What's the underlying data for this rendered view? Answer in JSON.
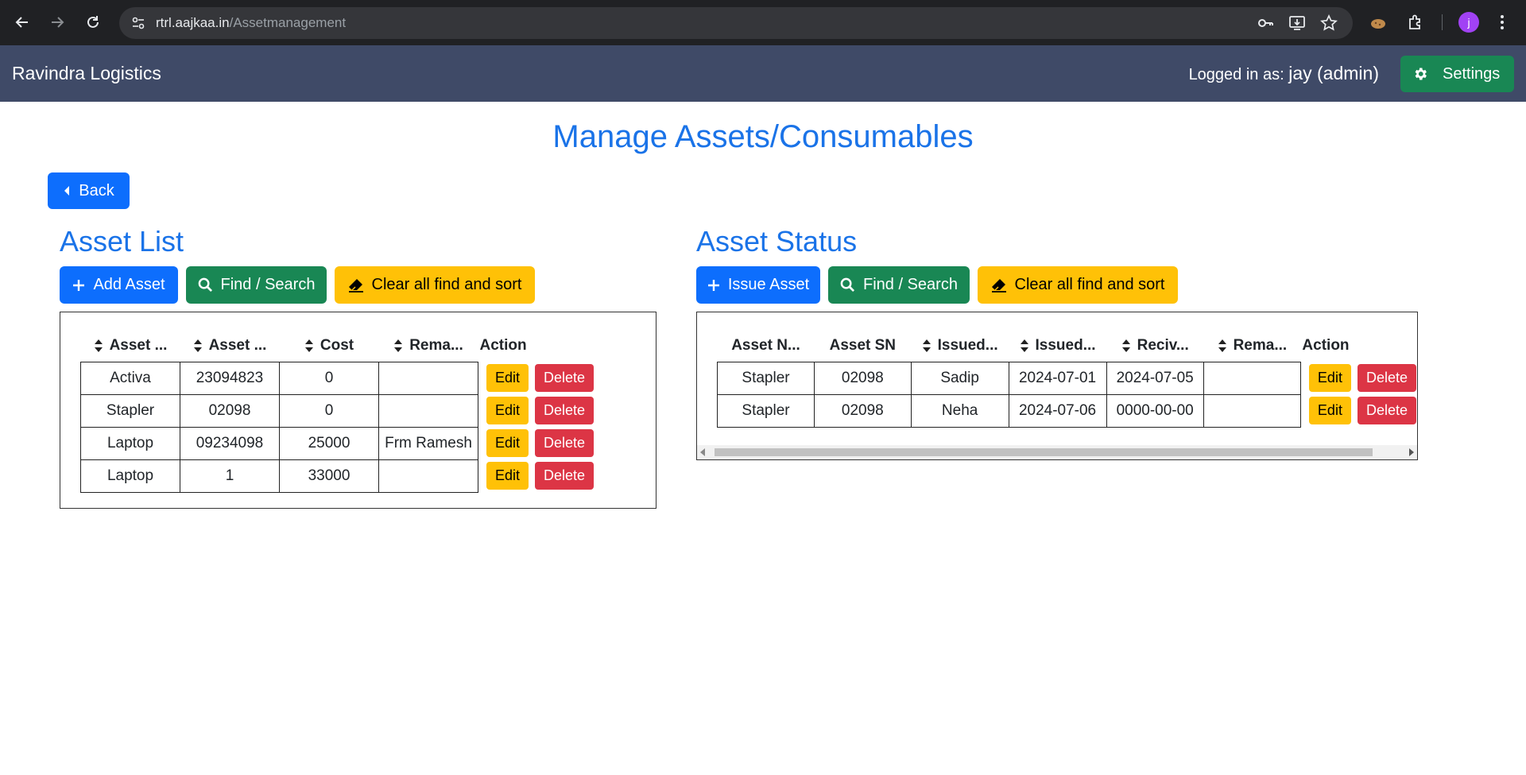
{
  "browser": {
    "url_host": "rtrl.aajkaa.in",
    "url_path": "/Assetmanagement",
    "avatar_letter": "j"
  },
  "navbar": {
    "brand": "Ravindra Logistics",
    "logged_label": "Logged in as:",
    "logged_user": "jay (admin)",
    "settings_label": "Settings"
  },
  "page": {
    "title": "Manage Assets/Consumables",
    "back_label": "Back"
  },
  "asset_list": {
    "heading": "Asset List",
    "buttons": {
      "add": "Add Asset",
      "find": "Find / Search",
      "clear": "Clear all find and sort"
    },
    "columns": [
      "Asset ...",
      "Asset ...",
      "Cost",
      "Rema...",
      "Action"
    ],
    "rows": [
      [
        "Activa",
        "23094823",
        "0",
        ""
      ],
      [
        "Stapler",
        "02098",
        "0",
        ""
      ],
      [
        "Laptop",
        "09234098",
        "25000",
        "Frm Ramesh"
      ],
      [
        "Laptop",
        "1",
        "33000",
        ""
      ]
    ],
    "edit_label": "Edit",
    "delete_label": "Delete"
  },
  "asset_status": {
    "heading": "Asset Status",
    "buttons": {
      "issue": "Issue Asset",
      "find": "Find / Search",
      "clear": "Clear all find and sort"
    },
    "columns": [
      "Asset N...",
      "Asset SN",
      "Issued...",
      "Issued...",
      "Reciv...",
      "Rema...",
      "Action"
    ],
    "rows": [
      [
        "Stapler",
        "02098",
        "Sadip",
        "2024-07-01",
        "2024-07-05",
        ""
      ],
      [
        "Stapler",
        "02098",
        "Neha",
        "2024-07-06",
        "0000-00-00",
        ""
      ]
    ],
    "edit_label": "Edit",
    "delete_label": "Delete"
  },
  "colors": {
    "navbar": "#3f4a67",
    "primary": "#0d6efd",
    "success": "#198754",
    "warning": "#ffc107",
    "danger": "#dc3545",
    "heading": "#1a73e8"
  }
}
